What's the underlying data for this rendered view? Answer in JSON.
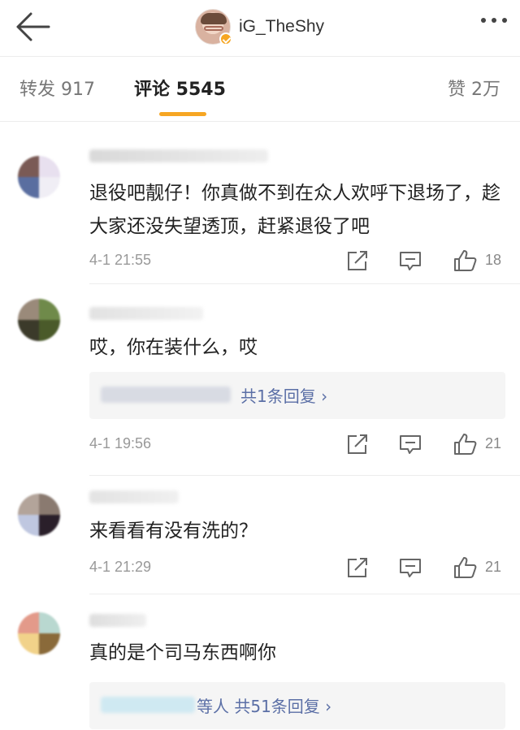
{
  "header": {
    "username": "iG_TheShy",
    "icons": [
      "back-arrow-icon",
      "avatar",
      "verified-badge-icon",
      "more-icon"
    ]
  },
  "tabs": {
    "repost": "转发 917",
    "comments": "评论 5545",
    "likes": "赞 2万",
    "active_color": "#f6a623"
  },
  "comments": [
    {
      "text": "退役吧靓仔！你真做不到在众人欢呼下退场了，趁大家还没失望透顶，赶紧退役了吧",
      "time": "4-1 21:55",
      "likes": "18"
    },
    {
      "text": "哎，你在装什么，哎",
      "replies": "共1条回复 ›",
      "time": "4-1 19:56",
      "likes": "21"
    },
    {
      "text": "来看看有没有洗的？",
      "time": "4-1 21:29",
      "likes": "21"
    },
    {
      "text": "真的是个司马东西啊你",
      "replies": "等人  共51条回复 ›"
    }
  ],
  "colors": {
    "link": "#5b6fa6",
    "meta": "#999999",
    "text": "#222222"
  }
}
